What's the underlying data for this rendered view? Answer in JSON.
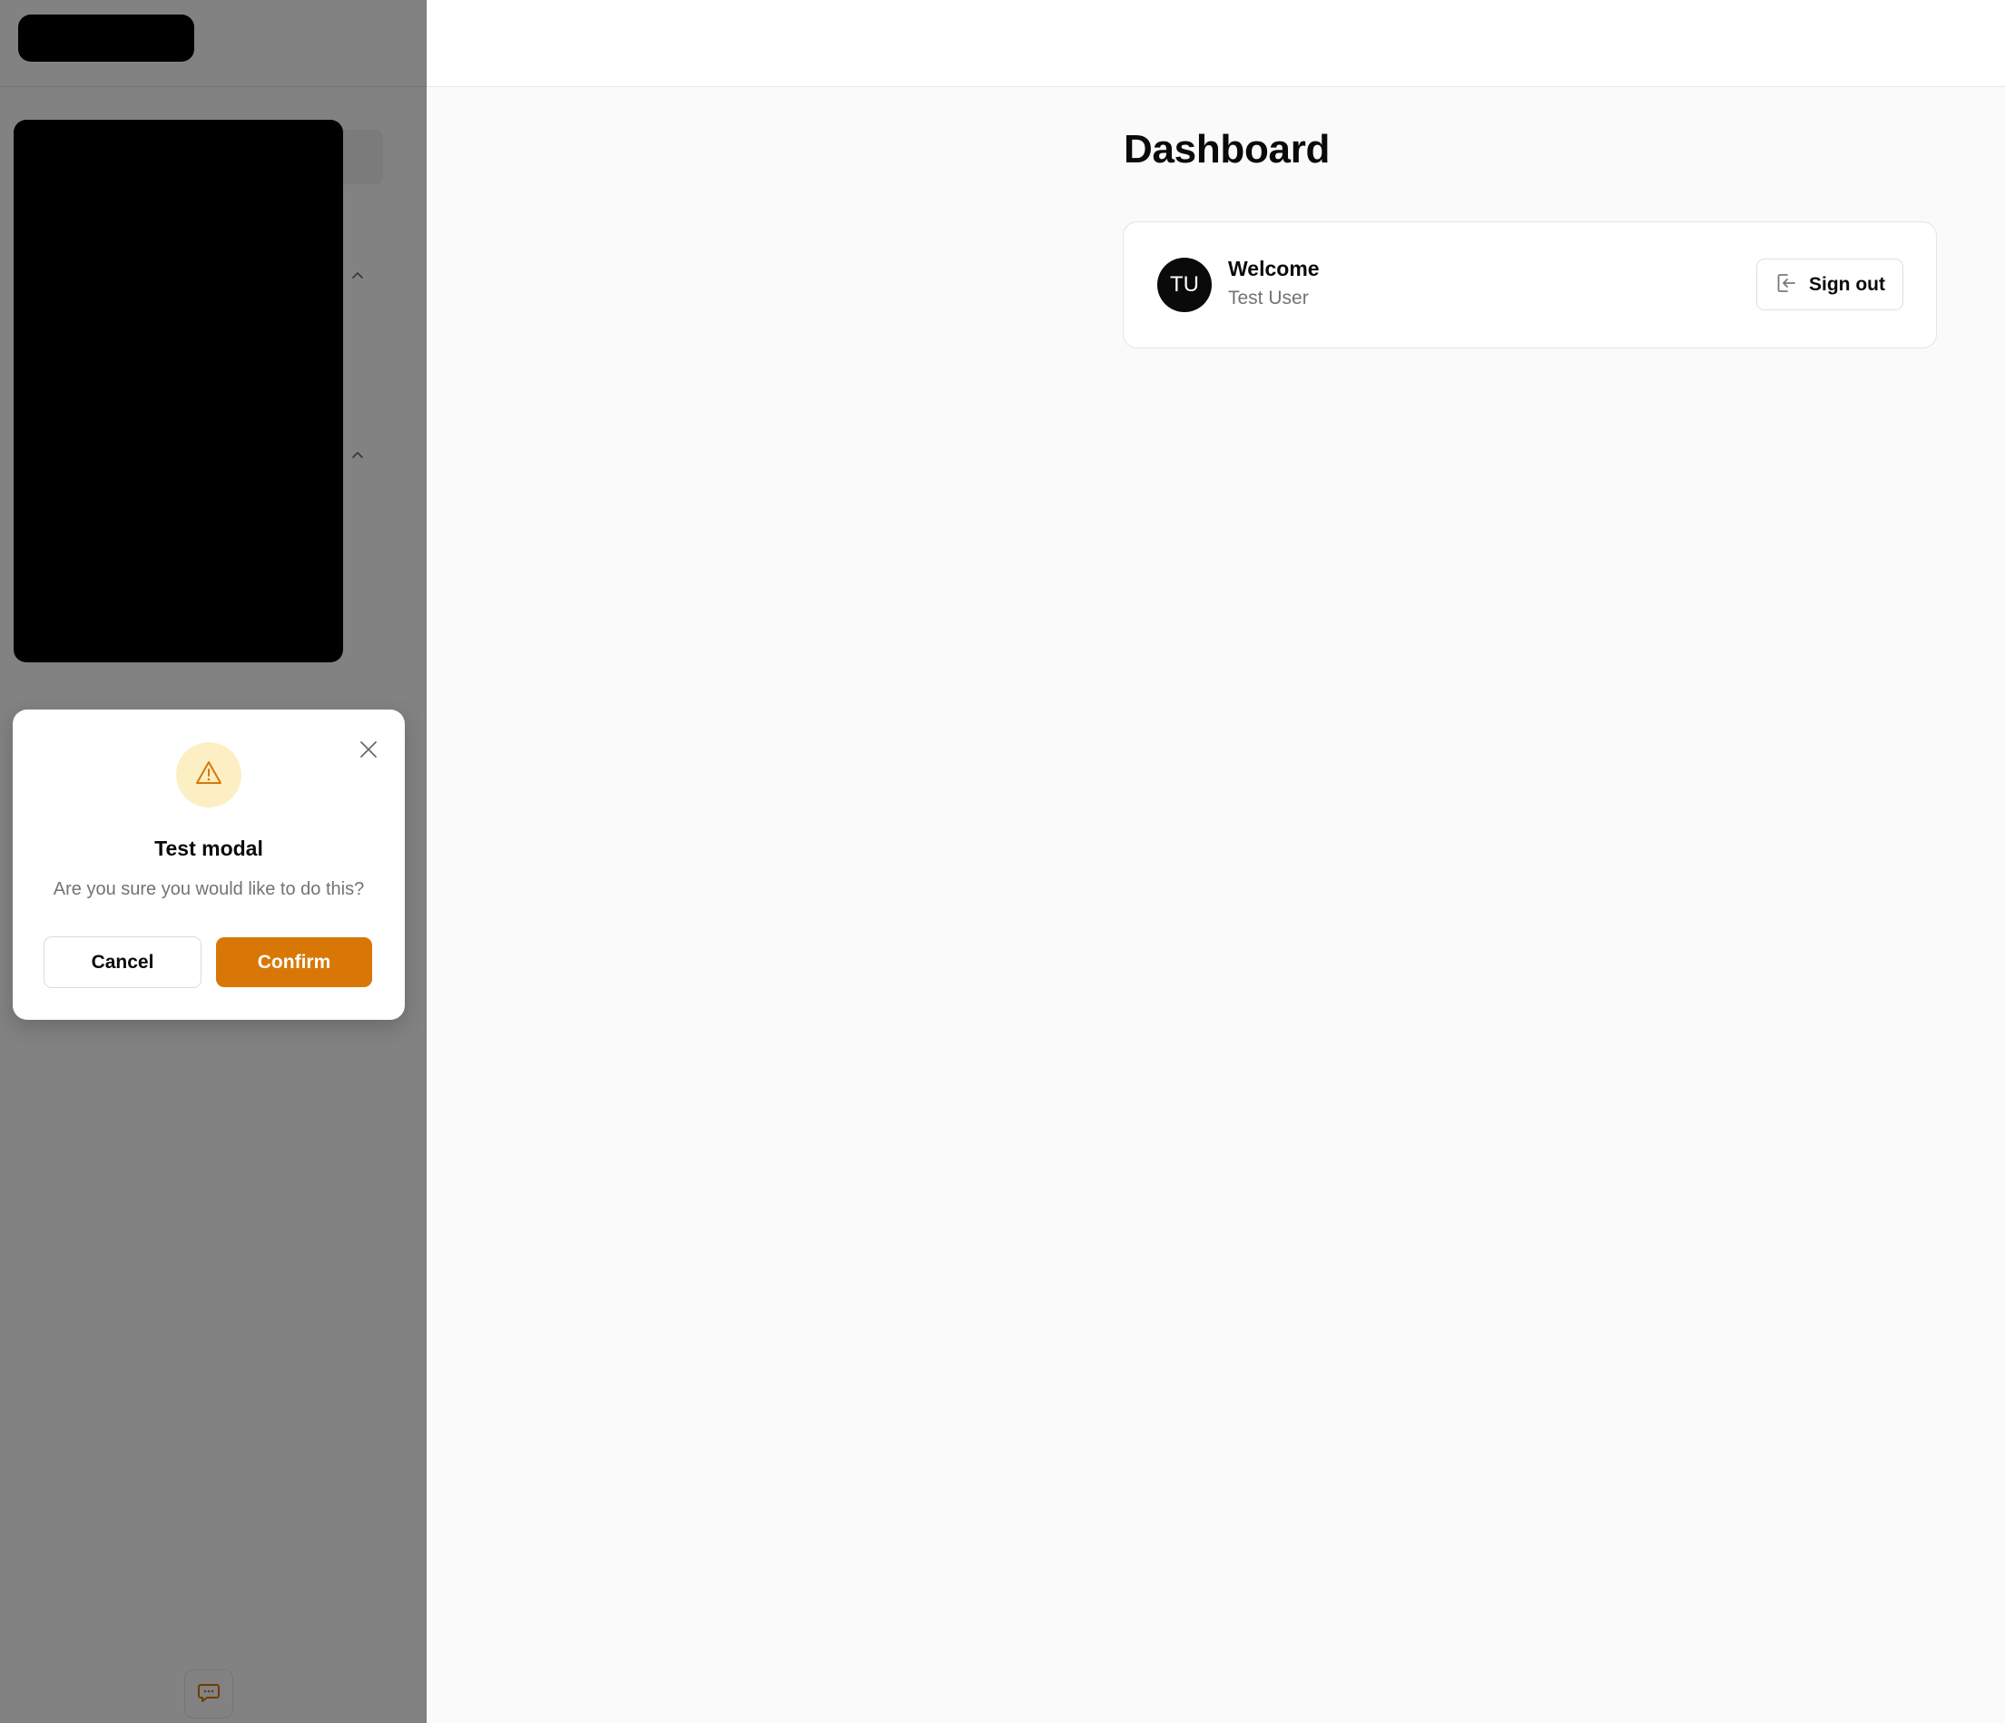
{
  "main": {
    "page_title": "Dashboard",
    "welcome_card": {
      "avatar_initials": "TU",
      "title": "Welcome",
      "user_name": "Test User",
      "signout_label": "Sign out",
      "signout_icon": "sign-out-icon"
    }
  },
  "sidebar": {
    "collapse_icon": "chevron-up-icon",
    "support_icon": "chat-bubble-icon"
  },
  "modal": {
    "icon": "warning-triangle-icon",
    "title": "Test modal",
    "message": "Are you sure you would like to do this?",
    "cancel_label": "Cancel",
    "confirm_label": "Confirm",
    "close_icon": "close-icon"
  },
  "colors": {
    "accent": "#d97706",
    "warning_bg": "#fdefc4",
    "avatar_bg": "#0a0a0a",
    "muted_text": "#737373"
  }
}
